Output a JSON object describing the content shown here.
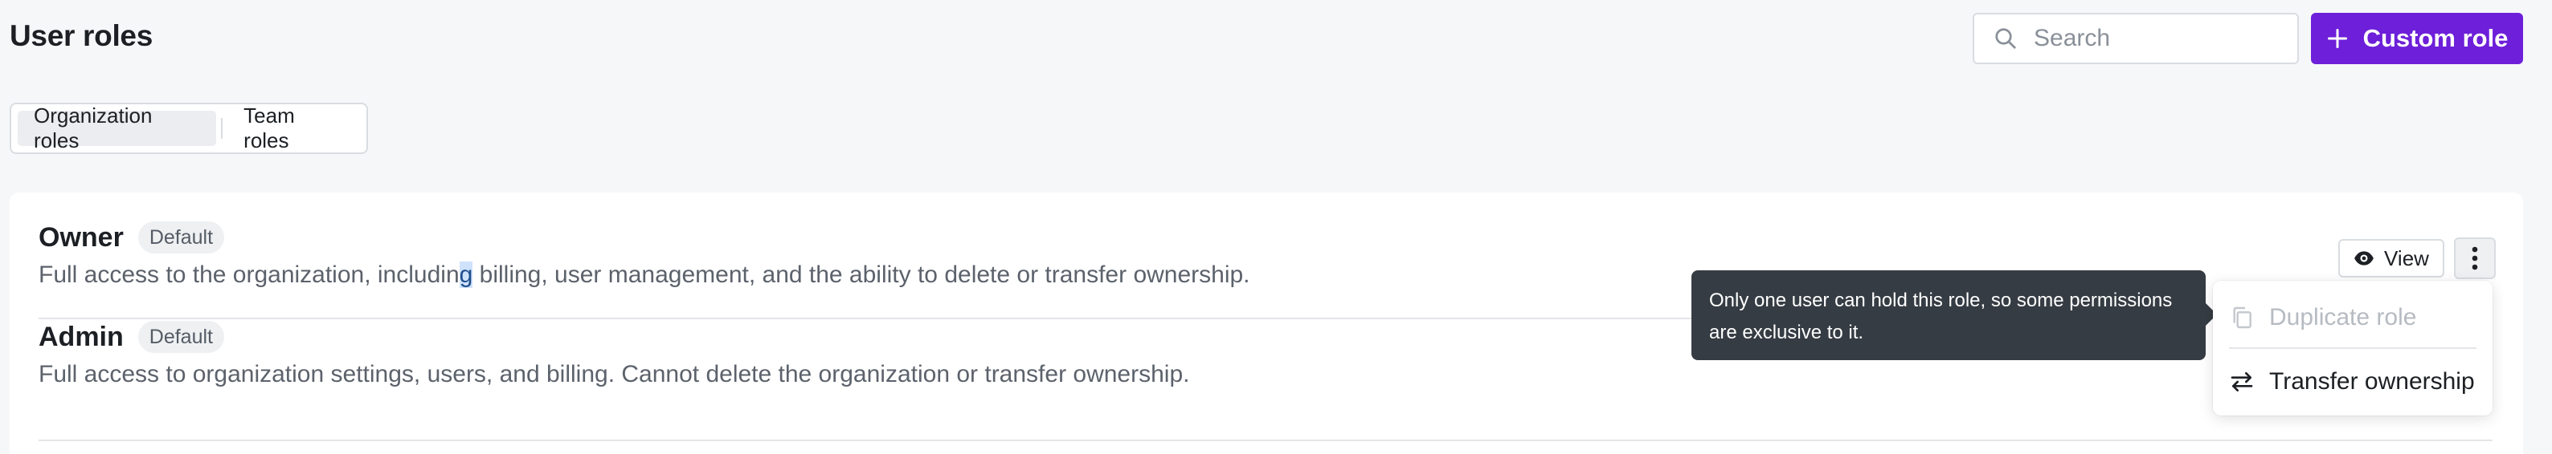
{
  "header": {
    "title": "User roles",
    "search_placeholder": "Search",
    "custom_role_label": "Custom role",
    "accent_color": "#6d1fd9"
  },
  "tabs": [
    {
      "label": "Organization roles",
      "active": true
    },
    {
      "label": "Team roles",
      "active": false
    }
  ],
  "roles": [
    {
      "name": "Owner",
      "badge": "Default",
      "desc_before": "Full access to the organization, includin",
      "desc_selected": "g",
      "desc_after": " billing, user management, and the ability to delete or transfer ownership.",
      "view_label": "View"
    },
    {
      "name": "Admin",
      "badge": "Default",
      "description": "Full access to organization settings, users, and billing. Cannot delete the organization or transfer ownership."
    }
  ],
  "tooltip": {
    "text": "Only one user can hold this role, so some permissions are exclusive to it."
  },
  "menu": {
    "items": [
      {
        "label": "Duplicate role",
        "icon": "copy-icon",
        "disabled": true
      },
      {
        "label": "Transfer ownership",
        "icon": "swap-arrows-icon",
        "disabled": false
      }
    ]
  }
}
